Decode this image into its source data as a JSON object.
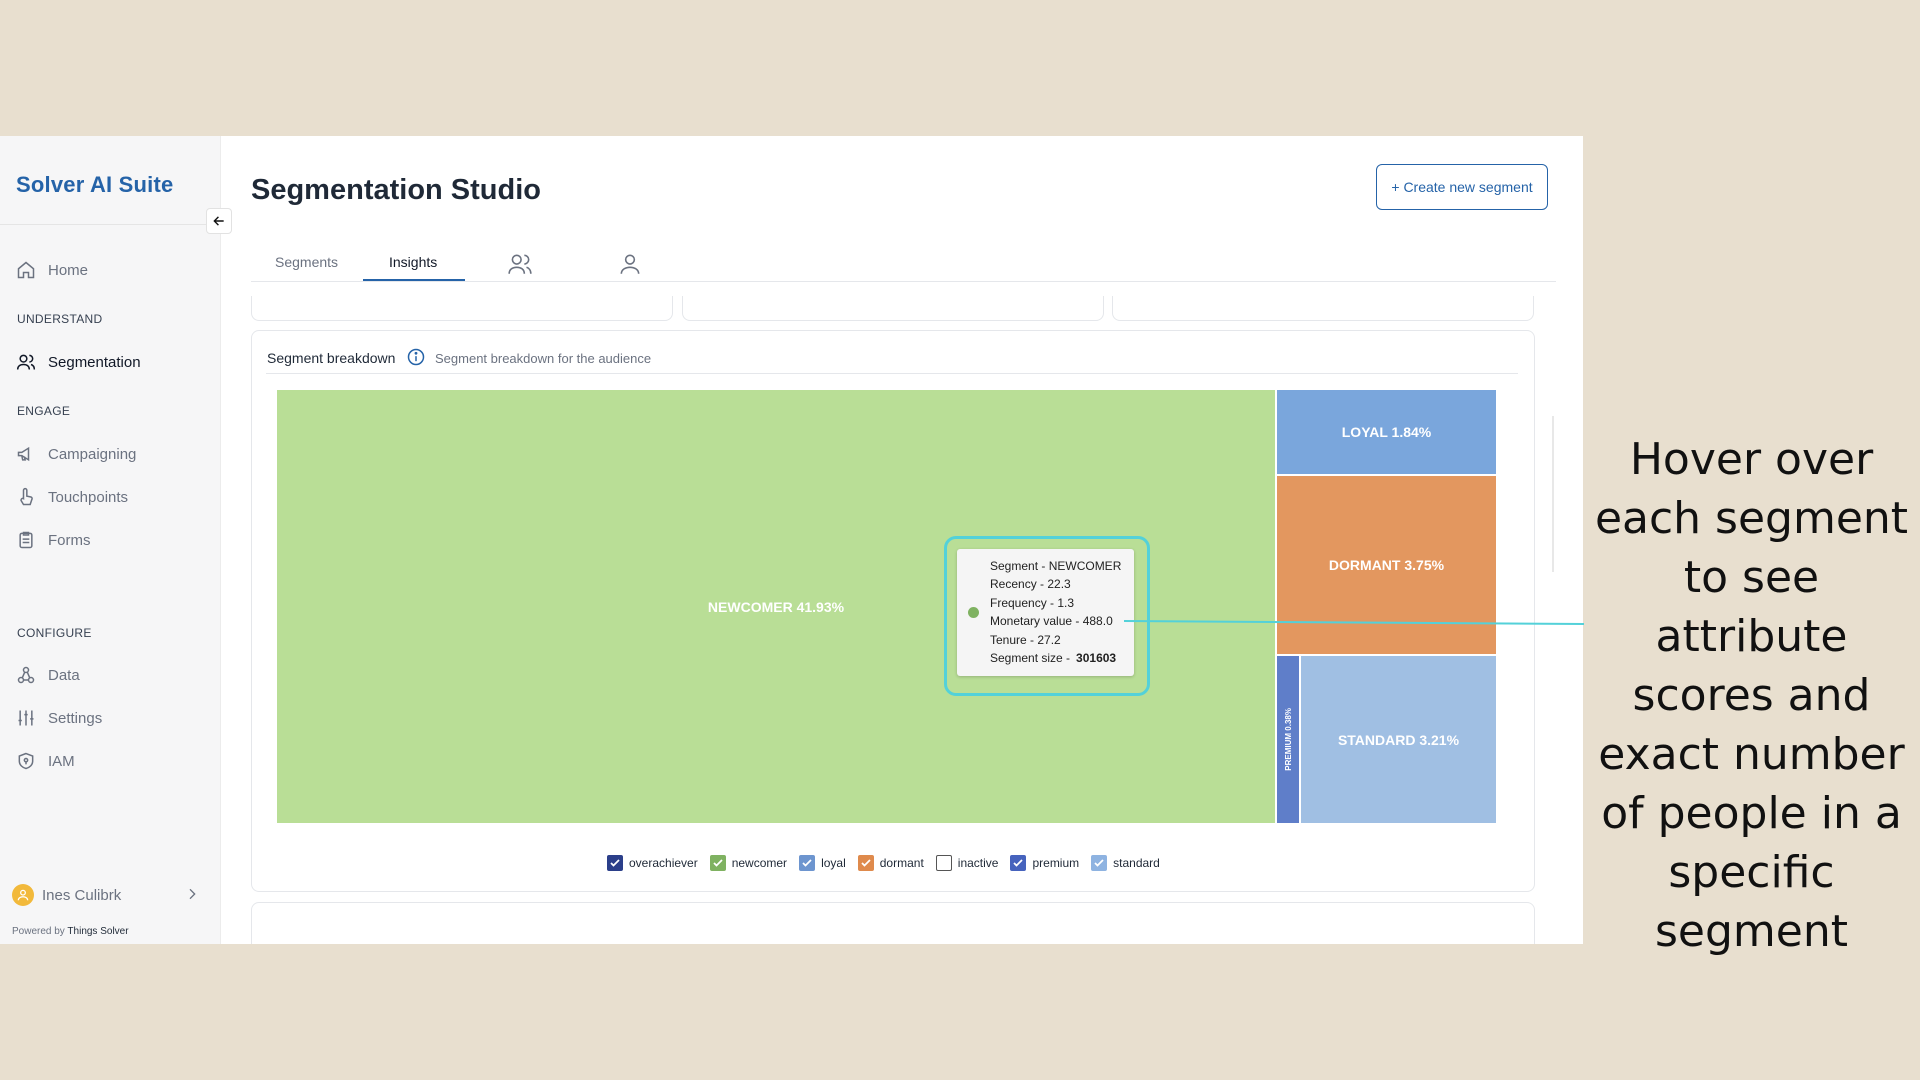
{
  "app": {
    "logo": "Solver AI Suite",
    "page_title": "Segmentation Studio",
    "create_button": "+ Create new segment"
  },
  "sidebar": {
    "home": "Home",
    "section_understand": "UNDERSTAND",
    "segmentation": "Segmentation",
    "section_engage": "ENGAGE",
    "campaigning": "Campaigning",
    "touchpoints": "Touchpoints",
    "forms": "Forms",
    "section_configure": "CONFIGURE",
    "data": "Data",
    "settings": "Settings",
    "iam": "IAM",
    "user_name": "Ines Culibrk",
    "powered_prefix": "Powered by",
    "powered_brand": "Things Solver"
  },
  "tabs": {
    "segments": "Segments",
    "insights": "Insights",
    "icons": [
      "users-icon",
      "user-icon"
    ]
  },
  "panel": {
    "title": "Segment breakdown",
    "subtitle": "Segment breakdown for the audience"
  },
  "chart_data": {
    "type": "treemap",
    "segments": [
      {
        "name": "NEWCOMER",
        "label": "NEWCOMER 41.93%",
        "percent": 41.93,
        "color": "#b9de96"
      },
      {
        "name": "LOYAL",
        "label": "LOYAL 1.84%",
        "percent": 1.84,
        "color": "#7aa6dc"
      },
      {
        "name": "DORMANT",
        "label": "DORMANT 3.75%",
        "percent": 3.75,
        "color": "#e3975f"
      },
      {
        "name": "PREMIUM",
        "label": "PREMIUM 0.38%",
        "percent": 0.38,
        "color": "#5f7ec9"
      },
      {
        "name": "STANDARD",
        "label": "STANDARD 3.21%",
        "percent": 3.21,
        "color": "#a0bfe3"
      }
    ],
    "legend": [
      {
        "label": "overachiever",
        "checked": true,
        "color": "#2b3f8a"
      },
      {
        "label": "newcomer",
        "checked": true,
        "color": "#7fb261"
      },
      {
        "label": "loyal",
        "checked": true,
        "color": "#6d95cf"
      },
      {
        "label": "dormant",
        "checked": true,
        "color": "#df8a4c"
      },
      {
        "label": "inactive",
        "checked": false,
        "color": "#ffffff"
      },
      {
        "label": "premium",
        "checked": true,
        "color": "#4663bd"
      },
      {
        "label": "standard",
        "checked": true,
        "color": "#8eb3e1"
      }
    ]
  },
  "tooltip": {
    "segment": "Segment - NEWCOMER",
    "recency": "Recency - 22.3",
    "frequency": "Frequency - 1.3",
    "monetary": "Monetary value - 488.0",
    "tenure": "Tenure - 27.2",
    "size_label": "Segment size -",
    "size_value": "301603"
  },
  "caption": "Hover over each segment to see attribute scores and exact number of people in a specific segment"
}
